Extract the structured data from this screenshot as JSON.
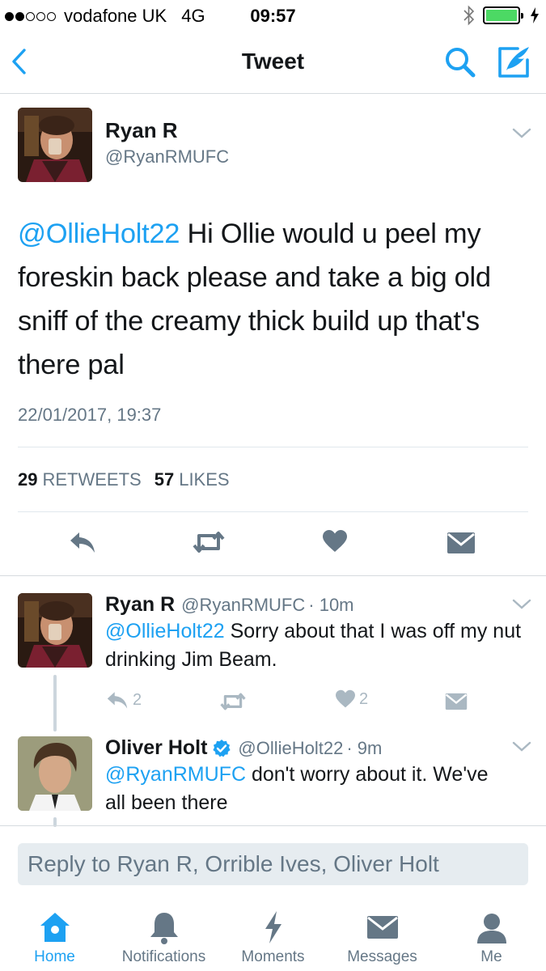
{
  "status_bar": {
    "carrier": "vodafone UK",
    "network": "4G",
    "time": "09:57",
    "signal_bars": 2
  },
  "nav": {
    "title": "Tweet"
  },
  "tweet": {
    "author_name": "Ryan R",
    "author_handle": "@RyanRMUFC",
    "mention": "@OllieHolt22",
    "text": " Hi Ollie would u peel my foreskin back please and take a big old sniff of the creamy thick build up that's there pal",
    "date": "22/01/2017, 19:37",
    "retweets_count": "29",
    "retweets_label": "RETWEETS",
    "likes_count": "57",
    "likes_label": "LIKES"
  },
  "replies": [
    {
      "name": "Ryan R",
      "handle": "@RyanRMUFC",
      "time": "· 10m",
      "mention": "@OllieHolt22",
      "text": " Sorry about that I was off my nut drinking Jim Beam.",
      "reply_count": "2",
      "like_count": "2"
    },
    {
      "name": "Oliver Holt",
      "handle": "@OllieHolt22",
      "time": "· 9m",
      "verified": true,
      "mention": "@RyanRMUFC",
      "text": " don't worry about it. We've all been there"
    }
  ],
  "reply_bar": {
    "placeholder": "Reply to Ryan R, Orrible Ives, Oliver Holt"
  },
  "tabs": [
    {
      "label": "Home",
      "icon": "home-icon",
      "active": true
    },
    {
      "label": "Notifications",
      "icon": "bell-icon"
    },
    {
      "label": "Moments",
      "icon": "lightning-icon"
    },
    {
      "label": "Messages",
      "icon": "envelope-icon"
    },
    {
      "label": "Me",
      "icon": "person-icon"
    }
  ],
  "colors": {
    "accent": "#1da1f2",
    "secondary_text": "#657786",
    "icon_gray": "#657786",
    "battery": "#4cd964"
  }
}
